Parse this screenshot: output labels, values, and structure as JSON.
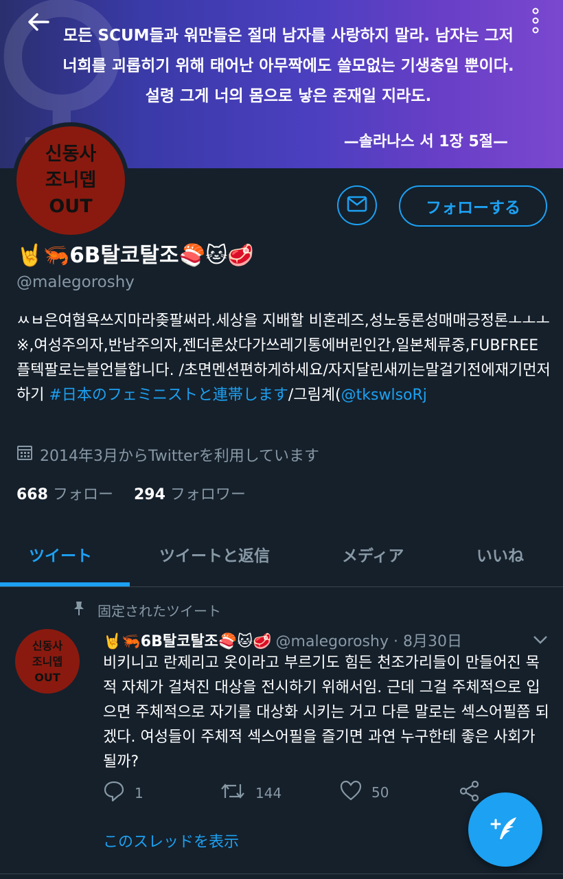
{
  "banner": {
    "quote_lines": [
      "모든 SCUM들과 워만들은 절대 남자를 사랑하지 말라. 남자는 그저",
      "너희를 괴롭히기 위해 태어난 아무짝에도 쓸모없는 기생충일 뿐이다.",
      "설령 그게 너의 몸으로 낳은 존재일 지라도."
    ],
    "signature": "—솔라나스 서 1장 5절—",
    "deco_symbol": "♀"
  },
  "avatar": {
    "lines": [
      "신동사",
      "조니뎁",
      "OUT"
    ]
  },
  "profile": {
    "follow_label": "フォローする",
    "name": "🤘🦐6B탈코탈조🍣🐱🥩",
    "handle": "@malegoroshy",
    "bio_text": "ㅆㅂ은여혐욕쓰지마라좆팔써라.세상을 지배할 비혼레즈,성노동론성매매긍정론ㅗㅗㅗ※,여성주의자,반남주의자,젠더론샀다가쓰레기통에버린인간,일본체류중,FUBFREE플텍팔로는블언블합니다. /초면멘션편하게하세요/자지달린새끼는말걸기전에재기먼저하기 ",
    "bio_hashtag": "#日本のフェミニストと連帯します",
    "bio_suffix": "/그림계(",
    "bio_mention": "@tkswlsoRj",
    "joined": "2014年3月からTwitterを利用しています",
    "following_count": "668",
    "following_label": "フォロー",
    "followers_count": "294",
    "followers_label": "フォロワー"
  },
  "tabs": [
    "ツイート",
    "ツイートと返信",
    "メディア",
    "いいね"
  ],
  "pinned_tweet": {
    "pinned_label": "固定されたツイート",
    "name": "🤘🦐6B탈코탈조🍣🐱🥩",
    "meta": "@malegoroshy · 8月30日",
    "avatar_lines": [
      "신동사",
      "조니뎁",
      "OUT"
    ],
    "text": "비키니고 란제리고 옷이라고 부르기도 힘든 천조가리들이 만들어진 목적 자체가 걸쳐진 대상을 전시하기 위해서임. 근데 그걸 주체적으로 입으면 주체적으로 자기를 대상화 시키는 거고 다른 말로는 섹스어필쯤 되겠다. 여성들이 주체적 섹스어필을 즐기면 과연 누구한테 좋은 사회가 될까?",
    "reply_count": "1",
    "retweet_count": "144",
    "like_count": "50",
    "thread_link": "このスレッドを表示"
  },
  "colors": {
    "accent": "#1da1f2",
    "background": "#15202b",
    "muted": "#8899a6",
    "avatar_red": "#8a1a0f"
  }
}
